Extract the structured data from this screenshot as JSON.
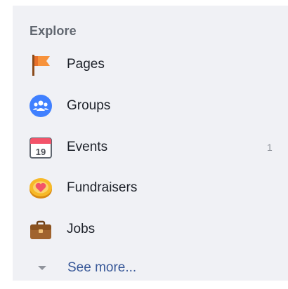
{
  "explore": {
    "heading": "Explore",
    "items": [
      {
        "label": "Pages",
        "icon": "flag-icon",
        "count": ""
      },
      {
        "label": "Groups",
        "icon": "groups-icon",
        "count": ""
      },
      {
        "label": "Events",
        "icon": "calendar-icon",
        "count": "1",
        "icon_text": "19"
      },
      {
        "label": "Fundraisers",
        "icon": "heart-coin-icon",
        "count": ""
      },
      {
        "label": "Jobs",
        "icon": "briefcase-icon",
        "count": ""
      }
    ],
    "see_more": "See more..."
  },
  "colors": {
    "panel_bg": "#f0f1f5",
    "heading": "#616770",
    "label": "#1d2129",
    "link": "#385898",
    "groups_blue": "#4080ff",
    "flag_orange": "#f7923b",
    "calendar_red": "#f35369",
    "fundraiser_gold": "#f7b928",
    "briefcase_brown": "#a0632e"
  }
}
